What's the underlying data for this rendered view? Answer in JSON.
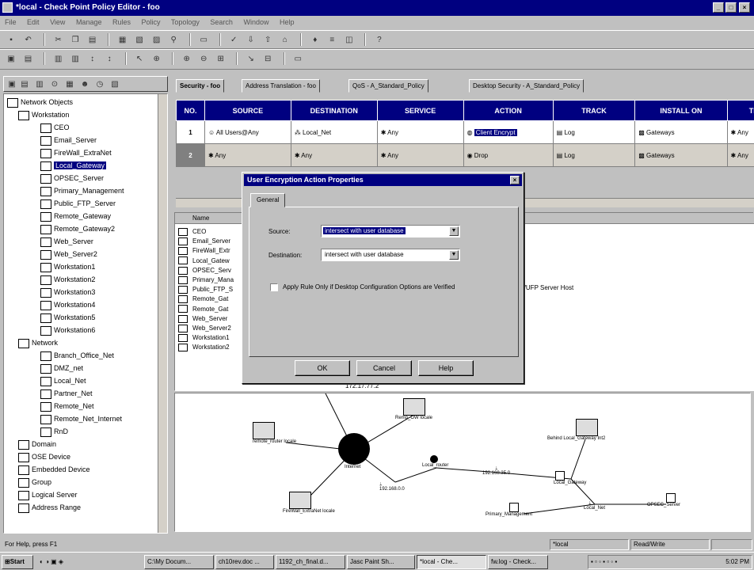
{
  "window": {
    "title": "*local - Check Point Policy Editor - foo"
  },
  "menu": [
    "File",
    "Edit",
    "View",
    "Manage",
    "Rules",
    "Policy",
    "Topology",
    "Search",
    "Window",
    "Help"
  ],
  "toolbar1": [
    "save",
    "undo",
    "cut",
    "copy",
    "paste",
    "find",
    "view",
    "add",
    "install",
    "verify",
    "help"
  ],
  "toolbar2": [
    "tree",
    "list",
    "grid",
    "sort",
    "select",
    "zoom",
    "fit",
    "link",
    "print"
  ],
  "tree": {
    "root": "Network Objects",
    "workstation_group": "Workstation",
    "workstations": [
      "CEO",
      "Email_Server",
      "FireWall_ExtraNet",
      "Local_Gateway",
      "OPSEC_Server",
      "Primary_Management",
      "Public_FTP_Server",
      "Remote_Gateway",
      "Remote_Gateway2",
      "Web_Server",
      "Web_Server2",
      "Workstation1",
      "Workstation2",
      "Workstation3",
      "Workstation4",
      "Workstation5",
      "Workstation6"
    ],
    "selected": "Local_Gateway",
    "network_group": "Network",
    "networks": [
      "Branch_Office_Net",
      "DMZ_net",
      "Local_Net",
      "Partner_Net",
      "Remote_Net",
      "Remote_Net_Internet",
      "RnD"
    ],
    "other_groups": [
      "Domain",
      "OSE Device",
      "Embedded Device",
      "Group",
      "Logical Server",
      "Address Range"
    ]
  },
  "tabs": [
    "Security - foo",
    "Address Translation - foo",
    "QoS - A_Standard_Policy",
    "Desktop Security - A_Standard_Policy"
  ],
  "rules": {
    "headers": [
      "NO.",
      "SOURCE",
      "DESTINATION",
      "SERVICE",
      "ACTION",
      "TRACK",
      "INSTALL ON",
      "TI"
    ],
    "rows": [
      {
        "no": "1",
        "source": "All Users@Any",
        "destination": "Local_Net",
        "service": "Any",
        "action": "Client Encrypt",
        "track": "Log",
        "install": "Gateways",
        "time": "Any"
      },
      {
        "no": "2",
        "source": "Any",
        "destination": "Any",
        "service": "Any",
        "action": "Drop",
        "track": "Log",
        "install": "Gateways",
        "time": "Any"
      }
    ]
  },
  "list": {
    "header": "Name",
    "items": [
      "CEO",
      "Email_Server",
      "FireWall_Extr",
      "Local_Gatew",
      "OPSEC_Serv",
      "Primary_Mana",
      "Public_FTP_S",
      "Remote_Gat",
      "Remote_Gat",
      "Web_Server",
      "Web_Server2",
      "Workstation1",
      "Workstation2"
    ],
    "extra": "ind/UFP Server Host",
    "ip": "172.17.77.2"
  },
  "dialog": {
    "title": "User Encryption Action Properties",
    "tab": "General",
    "source_label": "Source:",
    "source_value": "intersect with user database",
    "dest_label": "Destination:",
    "dest_value": "intersect with user database",
    "checkbox_label": "Apply Rule Only if Desktop Configuration Options are Verified",
    "ok": "OK",
    "cancel": "Cancel",
    "help": "Help"
  },
  "map": {
    "nodes": [
      {
        "label": "remote_router locale"
      },
      {
        "label": "Remp_OW locale"
      },
      {
        "label": "Internet"
      },
      {
        "label": "Local_router"
      },
      {
        "label": "192.168.0.0"
      },
      {
        "label": "192.168.35.0"
      },
      {
        "label": "FireWall_ExtraNet locale"
      },
      {
        "label": "Primary_Management"
      },
      {
        "label": "Behind Local_Gateway Int2"
      },
      {
        "label": "Local_Gateway"
      },
      {
        "label": "Local_Net"
      },
      {
        "label": "OPSEC_Server"
      }
    ]
  },
  "status": {
    "help": "For Help, press F1",
    "db": "*local",
    "mode": "Read/Write"
  },
  "taskbar": {
    "start": "Start",
    "tasks": [
      "C:\\My Docum...",
      "ch10rev.doc ...",
      "1192_ch_final.d...",
      "Jasc Paint Sh...",
      "*local - Che...",
      "fw.log - Check..."
    ],
    "clock": "5:02 PM"
  }
}
